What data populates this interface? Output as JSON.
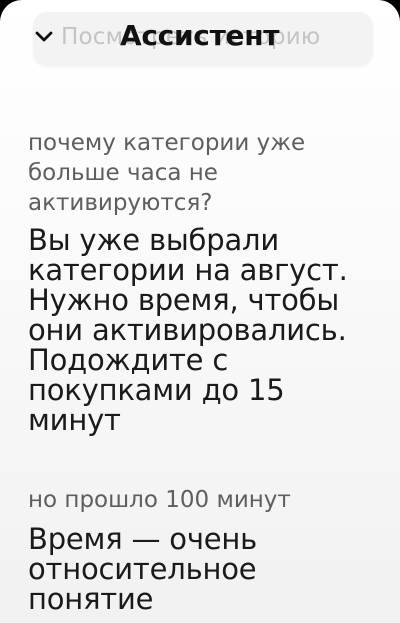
{
  "header": {
    "title": "Ассистент",
    "ghost_chip_text": "Посмотреть историю",
    "collapse_icon": "chevron-down-icon"
  },
  "messages": [
    {
      "role": "user",
      "text": "почему категории уже больше часа не активируются?"
    },
    {
      "role": "assistant",
      "text": "Вы уже выбрали категории на август. Нужно время, чтобы они активировались. Подождите с покупками до 15 минут"
    },
    {
      "role": "user",
      "text": "но прошло 100 минут"
    },
    {
      "role": "assistant",
      "text": "Время — очень относительное понятие"
    }
  ]
}
